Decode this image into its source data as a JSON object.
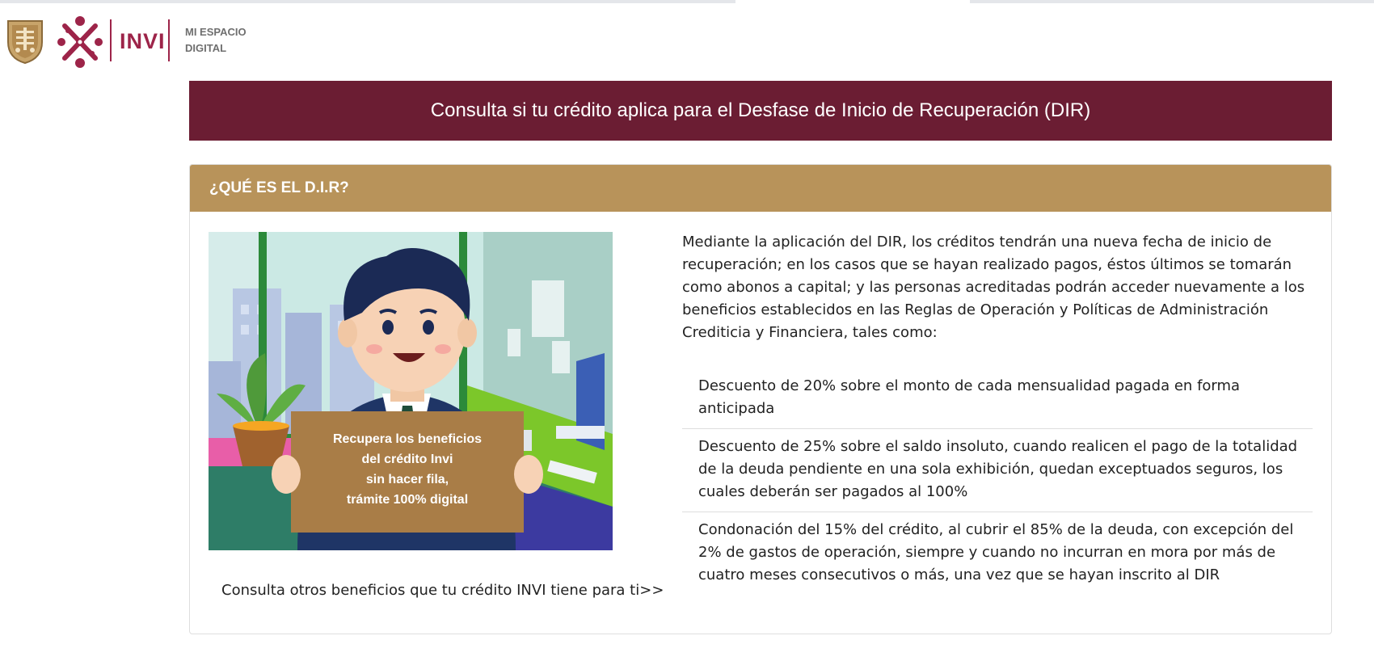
{
  "header": {
    "logo_text": "INVI",
    "tagline_line1": "MI ESPACIO",
    "tagline_line2": "DIGITAL"
  },
  "title_bar": {
    "title": "Consulta si tu crédito aplica para el Desfase de Inicio de Recuperación (DIR)"
  },
  "card": {
    "heading": "¿QUÉ ES EL D.I.R?",
    "sign_lines": [
      "Recupera los beneficios",
      "del crédito Invi",
      "sin hacer fila,",
      "trámite 100% digital"
    ],
    "link": "Consulta otros beneficios que tu crédito INVI tiene para ti>>",
    "intro": "Mediante la aplicación del DIR, los créditos tendrán una nueva fecha de inicio de recuperación; en los casos que se hayan realizado pagos, éstos últimos se tomarán como abonos a capital; y las personas acreditadas podrán acceder nuevamente a los beneficios establecidos en las Reglas de Operación y Políticas de Administración Crediticia y Financiera, tales como:",
    "benefits": [
      "Descuento de 20% sobre el monto de cada mensualidad pagada en forma anticipada",
      "Descuento de 25% sobre el saldo insoluto, cuando realicen el pago de la totalidad de la deuda pendiente en una sola exhibición, quedan exceptuados seguros, los cuales deberán ser pagados al 100%",
      "Condonación del 15% del crédito, al cubrir el 85% de la deuda, con excepción del 2% de gastos de operación, siempre y cuando no incurran en mora por más de cuatro meses consecutivos o más, una vez que se hayan inscrito al DIR"
    ]
  },
  "colors": {
    "title_bar_bg": "#6b1d33",
    "card_header_bg": "#b8935a",
    "brand_magenta": "#9d2449"
  }
}
